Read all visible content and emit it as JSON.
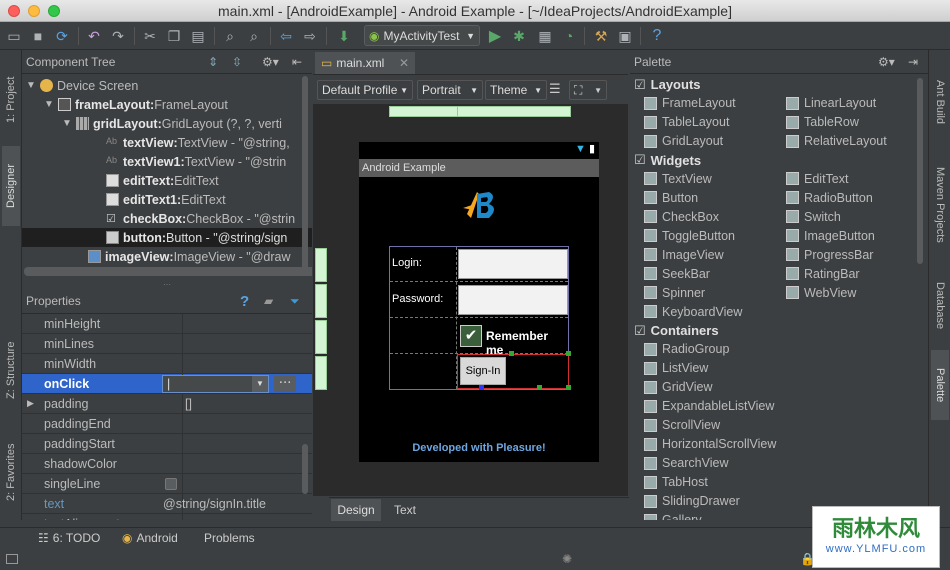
{
  "window": {
    "title": "main.xml - [AndroidExample] - Android Example - [~/IdeaProjects/AndroidExample]"
  },
  "toolbar": {
    "run_config": "MyActivityTest"
  },
  "left_tabs": {
    "project": "1: Project",
    "designer": "Designer",
    "structure": "Z: Structure",
    "favorites": "2: Favorites"
  },
  "right_tabs": {
    "ant": "Ant Build",
    "maven": "Maven Projects",
    "database": "Database",
    "palette": "Palette"
  },
  "component_tree": {
    "title": "Component Tree",
    "rows": [
      {
        "name": "Device Screen",
        "detail": ""
      },
      {
        "name": "frameLayout:",
        "detail": " FrameLayout"
      },
      {
        "name": "gridLayout:",
        "detail": " GridLayout (?, ?, verti"
      },
      {
        "name": "textView:",
        "detail": " TextView - \"@string,"
      },
      {
        "name": "textView1:",
        "detail": " TextView - \"@strin"
      },
      {
        "name": "editText:",
        "detail": " EditText"
      },
      {
        "name": "editText1:",
        "detail": " EditText"
      },
      {
        "name": "checkBox:",
        "detail": " CheckBox - \"@strin"
      },
      {
        "name": "button:",
        "detail": " Button - \"@string/sign"
      },
      {
        "name": "imageView:",
        "detail": " ImageView - \"@draw"
      }
    ]
  },
  "properties": {
    "title": "Properties",
    "rows": [
      {
        "name": "minHeight",
        "value": ""
      },
      {
        "name": "minLines",
        "value": ""
      },
      {
        "name": "minWidth",
        "value": ""
      },
      {
        "name": "onClick",
        "value": "|"
      },
      {
        "name": "padding",
        "value": "[]"
      },
      {
        "name": "paddingEnd",
        "value": ""
      },
      {
        "name": "paddingStart",
        "value": ""
      },
      {
        "name": "shadowColor",
        "value": ""
      },
      {
        "name": "singleLine",
        "value": ""
      },
      {
        "name": "text",
        "value": "@string/signIn.title"
      },
      {
        "name": "textAlignment",
        "value": ""
      }
    ]
  },
  "editor": {
    "tab": "main.xml",
    "profile": "Default Profile",
    "orientation": "Portrait",
    "theme": "Theme",
    "bottom_tabs": [
      "Design",
      "Text"
    ]
  },
  "device": {
    "app_title": "Android Example",
    "login_label": "Login:",
    "password_label": "Password:",
    "remember_label": "Remember me",
    "signin_label": "Sign-In",
    "footer": "Developed with Pleasure!"
  },
  "palette": {
    "title": "Palette",
    "categories": [
      {
        "name": "Layouts",
        "items": [
          "FrameLayout",
          "LinearLayout",
          "TableLayout",
          "TableRow",
          "GridLayout",
          "RelativeLayout"
        ]
      },
      {
        "name": "Widgets",
        "items": [
          "TextView",
          "EditText",
          "Button",
          "RadioButton",
          "CheckBox",
          "Switch",
          "ToggleButton",
          "ImageButton",
          "ImageView",
          "ProgressBar",
          "SeekBar",
          "RatingBar",
          "Spinner",
          "WebView",
          "KeyboardView"
        ]
      },
      {
        "name": "Containers",
        "items": [
          "RadioGroup",
          "ListView",
          "GridView",
          "ExpandableListView",
          "ScrollView",
          "HorizontalScrollView",
          "SearchView",
          "TabHost",
          "SlidingDrawer",
          "Gallery"
        ]
      }
    ]
  },
  "statusbar": {
    "todo": "6: TODO",
    "android": "Android",
    "problems": "Problems"
  },
  "watermark": {
    "name": "雨林木风",
    "url": "www.YLMFU.com"
  },
  "colors": {
    "accent": "#4b6eaf",
    "run": "#59a869",
    "android_blue": "#33b5e5"
  }
}
